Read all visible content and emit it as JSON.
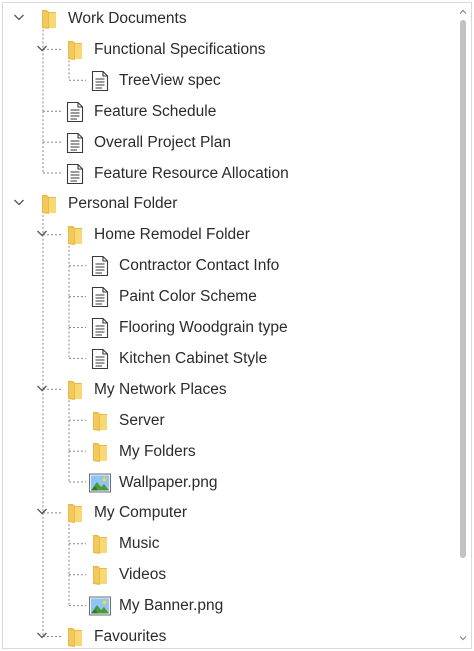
{
  "tree": {
    "nodes": [
      {
        "label": "Work Documents",
        "icon": "folder-icon",
        "level": 0,
        "expanded": true
      },
      {
        "label": "Functional Specifications",
        "icon": "folder-icon",
        "level": 1,
        "expanded": true
      },
      {
        "label": "TreeView spec",
        "icon": "document-icon",
        "level": 2
      },
      {
        "label": "Feature Schedule",
        "icon": "document-icon",
        "level": 1
      },
      {
        "label": "Overall Project Plan",
        "icon": "document-icon",
        "level": 1
      },
      {
        "label": "Feature Resource Allocation",
        "icon": "document-icon",
        "level": 1
      },
      {
        "label": "Personal Folder",
        "icon": "folder-icon",
        "level": 0,
        "expanded": true
      },
      {
        "label": "Home Remodel Folder",
        "icon": "folder-icon",
        "level": 1,
        "expanded": true
      },
      {
        "label": "Contractor Contact Info",
        "icon": "document-icon",
        "level": 2
      },
      {
        "label": "Paint Color Scheme",
        "icon": "document-icon",
        "level": 2
      },
      {
        "label": "Flooring Woodgrain type",
        "icon": "document-icon",
        "level": 2
      },
      {
        "label": "Kitchen Cabinet Style",
        "icon": "document-icon",
        "level": 2
      },
      {
        "label": "My Network Places",
        "icon": "folder-icon",
        "level": 1,
        "expanded": true
      },
      {
        "label": "Server",
        "icon": "folder-icon",
        "level": 2
      },
      {
        "label": "My Folders",
        "icon": "folder-icon",
        "level": 2
      },
      {
        "label": "Wallpaper.png",
        "icon": "image-icon",
        "level": 2
      },
      {
        "label": "My Computer",
        "icon": "folder-icon",
        "level": 1,
        "expanded": true
      },
      {
        "label": "Music",
        "icon": "folder-icon",
        "level": 2
      },
      {
        "label": "Videos",
        "icon": "folder-icon",
        "level": 2
      },
      {
        "label": "My Banner.png",
        "icon": "image-icon",
        "level": 2
      },
      {
        "label": "Favourites",
        "icon": "folder-icon",
        "level": 1,
        "expanded": true
      }
    ]
  },
  "colors": {
    "folder_light": "#f8d775",
    "folder_dark": "#e9b949",
    "connector": "#8a8a8a",
    "text": "#2b2b2b"
  }
}
